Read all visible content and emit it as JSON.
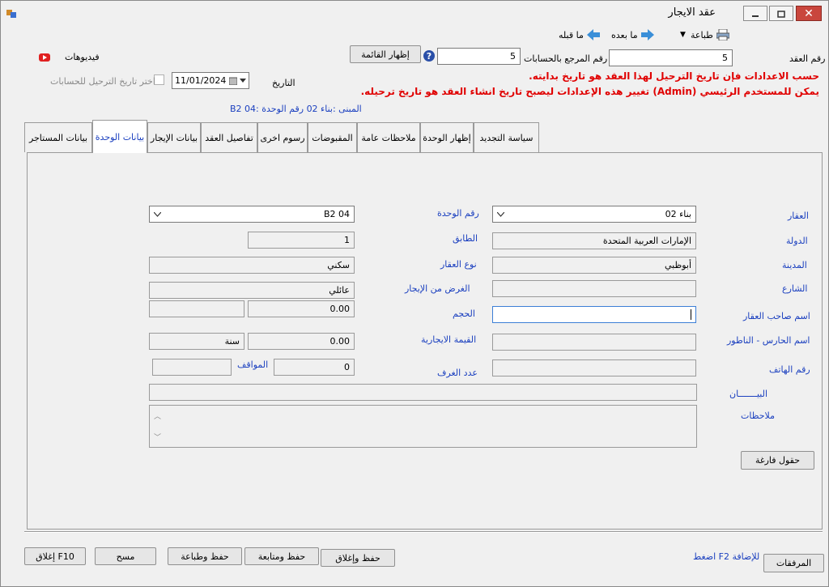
{
  "window": {
    "title": "عقد الايجار"
  },
  "toolbar": {
    "print": "طباعة",
    "next": "ما بعده",
    "prev": "ما قبله",
    "videos": "فيديوهات"
  },
  "header": {
    "contract_no_label": "رقم العقد",
    "contract_no_value": "5",
    "ref_label": "رقم المرجع بالحسابات",
    "ref_value": "5",
    "show_list": "إظهار القائمة",
    "date_label": "التاريخ",
    "date_value": "11/01/2024",
    "posting_checkbox": "اختر تاريخ الترحيل للحسابات",
    "notice_line1": "حسب الاعدادات فإن تاريخ الترحيل لهذا العقد هو تاريخ بدايته.",
    "notice_line2": "يمكن للمستخدم الرئيسي (Admin) تغيير هذه الإعدادات ليصبح تاريخ انشاء العقد هو تاريخ ترحيله.",
    "building_info": "المبنى :بناء 02 رقم الوحدة :04 B2"
  },
  "tabs": [
    {
      "label": "بيانات المستاجر"
    },
    {
      "label": "بيانات الوحدة"
    },
    {
      "label": "بيانات الإيجار"
    },
    {
      "label": "تفاصيل العقد"
    },
    {
      "label": "رسوم اخرى"
    },
    {
      "label": "المقبوضات"
    },
    {
      "label": "ملاحظات عامة"
    },
    {
      "label": "إظهار الوحدة"
    },
    {
      "label": "سياسة التجديد"
    }
  ],
  "active_tab": 1,
  "form": {
    "property_label": "العقار",
    "property_value": "بناء 02",
    "country_label": "الدولة",
    "country_value": "الإمارات العربية المتحدة",
    "city_label": "المدينة",
    "city_value": "أبوظبي",
    "street_label": "الشارع",
    "street_value": "",
    "owner_label": "اسم صاحب العقار",
    "owner_value": "",
    "guard_label": "اسم الحارس - الناطور",
    "guard_value": "",
    "phone_label": "رقم الهاتف",
    "phone_value": "",
    "statement_label": "البيـــــــان",
    "notes_label": "ملاحظات",
    "unit_no_label": "رقم الوحدة",
    "unit_no_value": "B2 04",
    "floor_label": "الطابق",
    "floor_value": "1",
    "property_type_label": "نوع العقار",
    "property_type_value": "سكني",
    "purpose_label": "الغرض من الإيجار",
    "purpose_value": "عائلي",
    "size_label": "الحجم",
    "size_value": "0.00",
    "rent_label": "القيمة الايجارية",
    "rent_value": "0.00",
    "rent_period": "سنة",
    "rooms_label": "عدد الغرف",
    "rooms_value": "0",
    "parking_label": "المواقف",
    "empty_fields_btn": "حقول فارغة"
  },
  "footer": {
    "attachments": "المرفقات",
    "hint": "اضغط F2 للإضافة",
    "save_close": "حفظ وإغلاق",
    "save_continue": "حفظ ومتابعة",
    "save_print": "حفظ وطباعة",
    "clear": "مسح",
    "close": "إغلاق F10"
  },
  "colors": {
    "accent": "#1a3fbf",
    "warning": "#e00000",
    "close_button": "#c9463d"
  }
}
